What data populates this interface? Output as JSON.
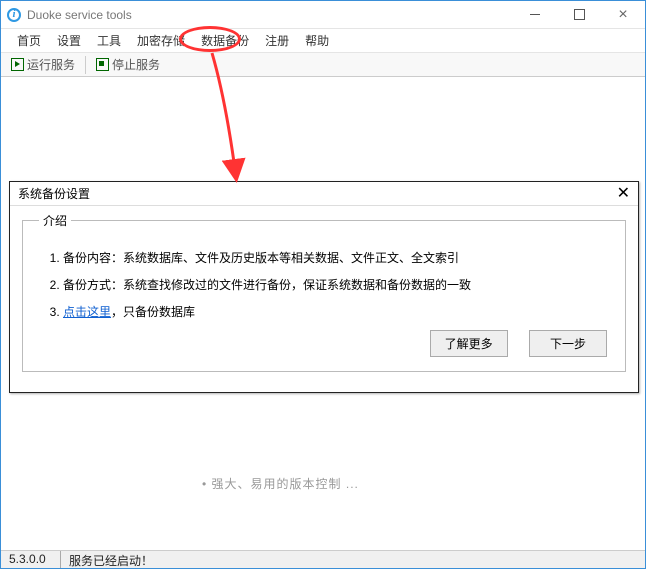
{
  "window": {
    "title": "Duoke service tools"
  },
  "menu": {
    "home": "首页",
    "settings": "设置",
    "tools": "工具",
    "encrypt": "加密存储",
    "backup": "数据备份",
    "register": "注册",
    "help": "帮助"
  },
  "toolbar": {
    "start": "运行服务",
    "stop": "停止服务"
  },
  "bgtext": "• 强大、易用的版本控制 ...",
  "dialog": {
    "title": "系统备份设置",
    "intro_legend": "介绍",
    "item1": "备份内容：系统数据库、文件及历史版本等相关数据、文件正文、全文索引",
    "item2": "备份方式：系统查找修改过的文件进行备份，保证系统数据和备份数据的一致",
    "item3_link": "点击这里",
    "item3_rest": "，只备份数据库",
    "learn_more": "了解更多",
    "next": "下一步"
  },
  "status": {
    "version": "5.3.0.0",
    "message": "服务已经启动！"
  }
}
